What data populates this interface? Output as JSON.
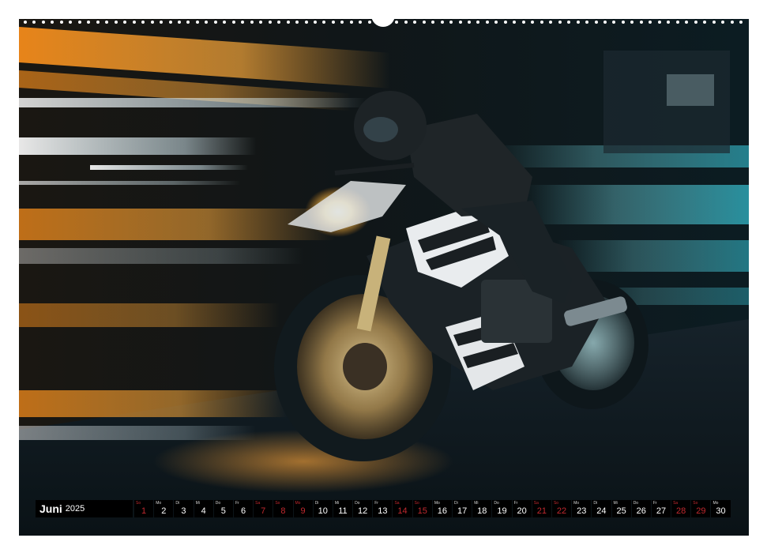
{
  "calendar": {
    "month": "Juni",
    "year": "2025",
    "weekend_color": "#c2292f",
    "days": [
      {
        "num": "1",
        "wd": "So",
        "weekend": true
      },
      {
        "num": "2",
        "wd": "Mo",
        "weekend": false
      },
      {
        "num": "3",
        "wd": "Di",
        "weekend": false
      },
      {
        "num": "4",
        "wd": "Mi",
        "weekend": false
      },
      {
        "num": "5",
        "wd": "Do",
        "weekend": false
      },
      {
        "num": "6",
        "wd": "Fr",
        "weekend": false
      },
      {
        "num": "7",
        "wd": "Sa",
        "weekend": true
      },
      {
        "num": "8",
        "wd": "So",
        "weekend": true
      },
      {
        "num": "9",
        "wd": "Mo",
        "weekend": true
      },
      {
        "num": "10",
        "wd": "Di",
        "weekend": false
      },
      {
        "num": "11",
        "wd": "Mi",
        "weekend": false
      },
      {
        "num": "12",
        "wd": "Do",
        "weekend": false
      },
      {
        "num": "13",
        "wd": "Fr",
        "weekend": false
      },
      {
        "num": "14",
        "wd": "Sa",
        "weekend": true
      },
      {
        "num": "15",
        "wd": "So",
        "weekend": true
      },
      {
        "num": "16",
        "wd": "Mo",
        "weekend": false
      },
      {
        "num": "17",
        "wd": "Di",
        "weekend": false
      },
      {
        "num": "18",
        "wd": "Mi",
        "weekend": false
      },
      {
        "num": "19",
        "wd": "Do",
        "weekend": false
      },
      {
        "num": "20",
        "wd": "Fr",
        "weekend": false
      },
      {
        "num": "21",
        "wd": "Sa",
        "weekend": true
      },
      {
        "num": "22",
        "wd": "So",
        "weekend": true
      },
      {
        "num": "23",
        "wd": "Mo",
        "weekend": false
      },
      {
        "num": "24",
        "wd": "Di",
        "weekend": false
      },
      {
        "num": "25",
        "wd": "Mi",
        "weekend": false
      },
      {
        "num": "26",
        "wd": "Do",
        "weekend": false
      },
      {
        "num": "27",
        "wd": "Fr",
        "weekend": false
      },
      {
        "num": "28",
        "wd": "Sa",
        "weekend": true
      },
      {
        "num": "29",
        "wd": "So",
        "weekend": true
      },
      {
        "num": "30",
        "wd": "Mo",
        "weekend": false
      }
    ]
  }
}
